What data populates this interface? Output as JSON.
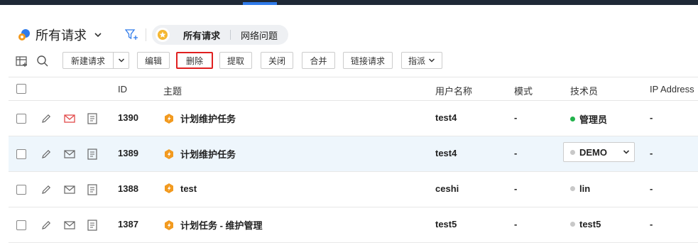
{
  "header": {
    "view_title": "所有请求",
    "tabs": [
      {
        "label": "所有请求",
        "active": true
      },
      {
        "label": "网络问题",
        "active": false
      }
    ]
  },
  "toolbar": {
    "new_request": "新建请求",
    "edit": "编辑",
    "delete": "删除",
    "pickup": "提取",
    "close": "关闭",
    "merge": "合并",
    "link_request": "链接请求",
    "assign": "指派",
    "highlighted": "删除"
  },
  "table": {
    "columns": {
      "id": "ID",
      "subject": "主题",
      "username": "用户名称",
      "mode": "模式",
      "technician": "技术员",
      "ip": "IP Address"
    },
    "rows": [
      {
        "id": "1390",
        "subject": "计划维护任务",
        "user": "test4",
        "mode": "-",
        "tech": "管理员",
        "tech_status": "online",
        "ip": "-",
        "mail_unread": true
      },
      {
        "id": "1389",
        "subject": "计划维护任务",
        "user": "test4",
        "mode": "-",
        "tech": "DEMO",
        "tech_status": "offline",
        "ip": "-",
        "selected": true
      },
      {
        "id": "1388",
        "subject": "test",
        "user": "ceshi",
        "mode": "-",
        "tech": "lin",
        "tech_status": "offline",
        "ip": "-"
      },
      {
        "id": "1387",
        "subject": "计划任务 - 维护管理",
        "user": "test5",
        "mode": "-",
        "tech": "test5",
        "tech_status": "offline",
        "ip": "-"
      }
    ]
  },
  "colors": {
    "accent": "#2f7bea",
    "highlight_border": "#e02020",
    "online": "#22b24c",
    "offline": "#c8c8c8",
    "subject_icon": "#f29a1f"
  }
}
